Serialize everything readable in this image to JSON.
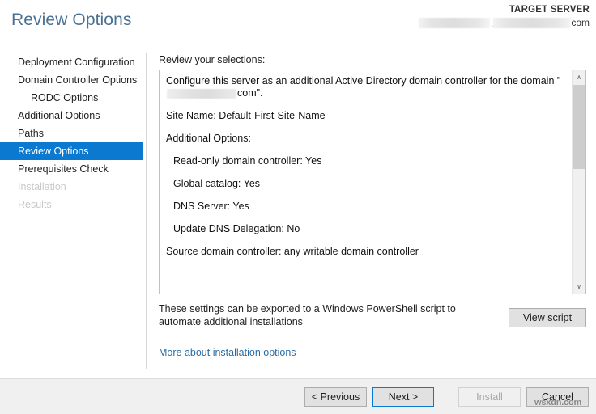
{
  "header": {
    "title": "Review Options",
    "target_server_label": "TARGET SERVER",
    "target_server_value_suffix": "com",
    "target_server_separator": "."
  },
  "sidebar": {
    "items": [
      {
        "label": "Deployment Configuration",
        "state": "normal",
        "indent": false
      },
      {
        "label": "Domain Controller Options",
        "state": "normal",
        "indent": false
      },
      {
        "label": "RODC Options",
        "state": "normal",
        "indent": true
      },
      {
        "label": "Additional Options",
        "state": "normal",
        "indent": false
      },
      {
        "label": "Paths",
        "state": "normal",
        "indent": false
      },
      {
        "label": "Review Options",
        "state": "selected",
        "indent": false
      },
      {
        "label": "Prerequisites Check",
        "state": "normal",
        "indent": false
      },
      {
        "label": "Installation",
        "state": "disabled",
        "indent": false
      },
      {
        "label": "Results",
        "state": "disabled",
        "indent": false
      }
    ]
  },
  "main": {
    "review_label": "Review your selections:",
    "selections": {
      "intro_before_domain": "Configure this server as an additional Active Directory domain controller for the domain \"",
      "intro_after_domain": "com\".",
      "site_name": "Site Name: Default-First-Site-Name",
      "additional_options_heading": "Additional Options:",
      "option_rodc": "Read-only domain controller: Yes",
      "option_global_catalog": "Global catalog: Yes",
      "option_dns_server": "DNS Server: Yes",
      "option_update_dns_delegation": "Update DNS Delegation: No",
      "source_domain_controller": "Source domain controller: any writable domain controller"
    },
    "export_text": "These settings can be exported to a Windows PowerShell script to automate additional installations",
    "view_script_label": "View script",
    "more_link_label": "More about installation options",
    "scrollbar": {
      "up_arrow_glyph": "∧",
      "down_arrow_glyph": "∨"
    }
  },
  "footer": {
    "previous_label": "< Previous",
    "next_label": "Next >",
    "install_label": "Install",
    "cancel_label": "Cancel"
  },
  "watermark": {
    "text": "wsxdn.com"
  },
  "colors": {
    "title": "#4a7191",
    "accent_blue": "#0b79d0",
    "link_blue": "#2b6ca3",
    "panel_border": "#a8c6df",
    "footer_bg": "#f0f0f0",
    "button_bg": "#e1e1e1",
    "button_border": "#adadad",
    "disabled_text": "#c9c9c9"
  }
}
